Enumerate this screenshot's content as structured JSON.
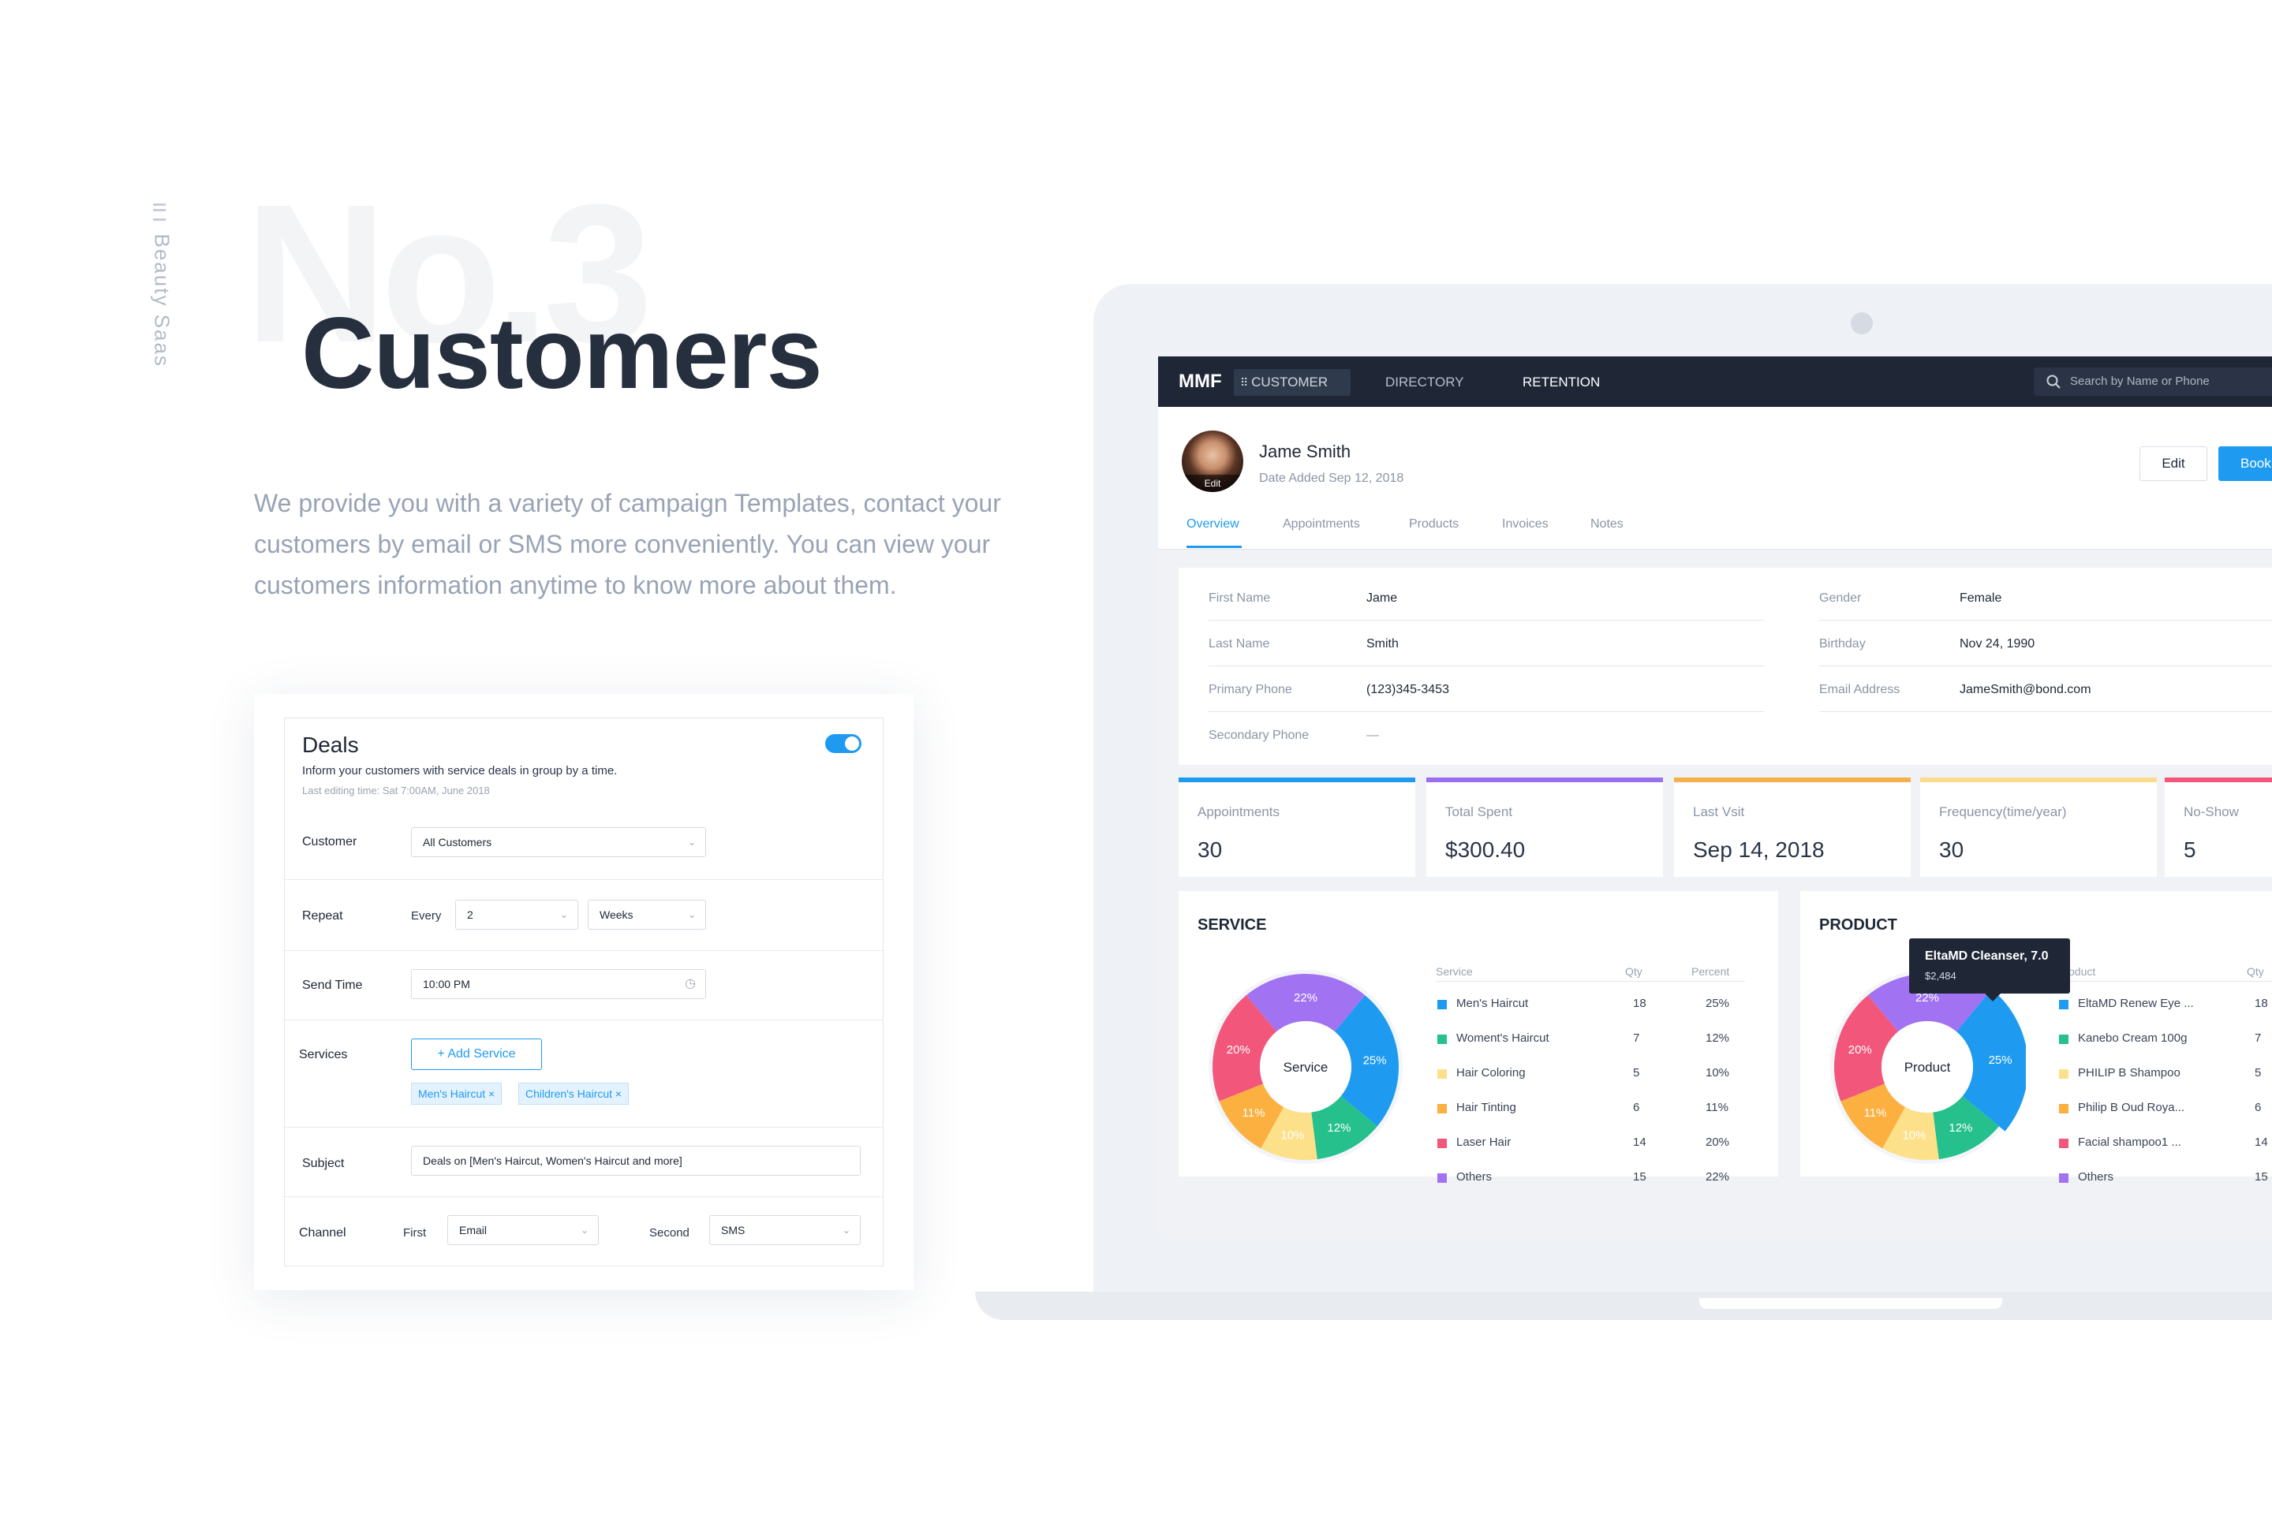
{
  "page": {
    "side_label": "Beauty Saas",
    "bg_number": "No.3",
    "title": "Customers",
    "description": "We provide you with a variety of campaign Templates, contact your customers by email or SMS more conveniently. You can view your customers information anytime to know more about them."
  },
  "deals": {
    "title": "Deals",
    "subtitle": "Inform your customers with service deals in group by a time.",
    "last_edit": "Last editing time: Sat 7:00AM, June 2018",
    "toggle_on": true,
    "customer_label": "Customer",
    "customer_value": "All Customers",
    "repeat_label": "Repeat",
    "every_label": "Every",
    "repeat_count": "2",
    "repeat_unit": "Weeks",
    "send_time_label": "Send Time",
    "send_time_value": "10:00 PM",
    "services_label": "Services",
    "add_service_label": "+ Add Service",
    "service_tags": [
      "Men's Haircut ×",
      "Children's Haircut ×"
    ],
    "subject_label": "Subject",
    "subject_value": "Deals on [Men's Haircut, Women's Haircut and more]",
    "channel_label": "Channel",
    "first_label": "First",
    "first_value": "Email",
    "second_label": "Second",
    "second_value": "SMS"
  },
  "nav": {
    "logo": "MMF",
    "items": [
      "CUSTOMER",
      "DIRECTORY",
      "RETENTION"
    ],
    "search_placeholder": "Search by Name or Phone"
  },
  "profile": {
    "name": "Jame Smith",
    "date_added": "Date Added Sep 12, 2018",
    "avatar_edit": "Edit",
    "edit_label": "Edit",
    "book_label": "Book",
    "tabs": [
      "Overview",
      "Appointments",
      "Products",
      "Invoices",
      "Notes"
    ]
  },
  "info": {
    "fields_left": [
      {
        "label": "First Name",
        "value": "Jame"
      },
      {
        "label": "Last Name",
        "value": "Smith"
      },
      {
        "label": "Primary Phone",
        "value": "(123)345-3453"
      },
      {
        "label": "Secondary Phone",
        "value": "—"
      }
    ],
    "fields_right": [
      {
        "label": "Gender",
        "value": "Female"
      },
      {
        "label": "Birthday",
        "value": "Nov 24, 1990"
      },
      {
        "label": "Email Address",
        "value": "JameSmith@bond.com"
      }
    ]
  },
  "stats": [
    {
      "label": "Appointments",
      "value": "30",
      "color": "#1e9bf0"
    },
    {
      "label": "Total Spent",
      "value": "$300.40",
      "color": "#9b6ef0"
    },
    {
      "label": "Last Vsit",
      "value": "Sep 14, 2018",
      "color": "#f6b04a"
    },
    {
      "label": "Frequency(time/year)",
      "value": "30",
      "color": "#fbdc8c"
    },
    {
      "label": "No-Show",
      "value": "5",
      "color": "#f2577b"
    }
  ],
  "service": {
    "title": "SERVICE",
    "center_label": "Service",
    "headers": [
      "Service",
      "Qty",
      "Percent"
    ],
    "rows": [
      {
        "name": "Men's Haircut",
        "qty": "18",
        "percent": "25%",
        "color": "#1e9bf0"
      },
      {
        "name": "Woment's Haircut",
        "qty": "7",
        "percent": "12%",
        "color": "#26c08c"
      },
      {
        "name": "Hair Coloring",
        "qty": "5",
        "percent": "10%",
        "color": "#fde08a"
      },
      {
        "name": "Hair Tinting",
        "qty": "6",
        "percent": "11%",
        "color": "#fbb040"
      },
      {
        "name": "Laser Hair",
        "qty": "14",
        "percent": "20%",
        "color": "#f2577b"
      },
      {
        "name": "Others",
        "qty": "15",
        "percent": "22%",
        "color": "#a173f2"
      }
    ]
  },
  "product": {
    "title": "PRODUCT",
    "center_label": "Product",
    "headers": [
      "Product",
      "Qty"
    ],
    "rows": [
      {
        "name": "EltaMD Renew Eye ...",
        "qty": "18",
        "color": "#1e9bf0"
      },
      {
        "name": "Kanebo Cream 100g",
        "qty": "7",
        "color": "#26c08c"
      },
      {
        "name": "PHILIP B Shampoo",
        "qty": "5",
        "color": "#fde08a"
      },
      {
        "name": "Philip B Oud Roya...",
        "qty": "6",
        "color": "#fbb040"
      },
      {
        "name": "Facial shampoo1 ...",
        "qty": "14",
        "color": "#f2577b"
      },
      {
        "name": "Others",
        "qty": "15",
        "color": "#a173f2"
      }
    ],
    "tooltip_title": "EltaMD Cleanser, 7.0",
    "tooltip_value": "$2,484"
  },
  "chart_data": [
    {
      "type": "pie",
      "title": "SERVICE",
      "categories": [
        "Men's Haircut",
        "Woment's Haircut",
        "Hair Coloring",
        "Hair Tinting",
        "Laser Hair",
        "Others"
      ],
      "values": [
        25,
        12,
        10,
        11,
        20,
        22
      ],
      "labels": [
        "25%",
        "12%",
        "10%",
        "11%",
        "20%",
        "22%"
      ],
      "colors": [
        "#1e9bf0",
        "#26c08c",
        "#fde08a",
        "#fbb040",
        "#f2577b",
        "#a173f2"
      ]
    },
    {
      "type": "pie",
      "title": "PRODUCT",
      "categories": [
        "EltaMD Renew Eye ...",
        "Kanebo Cream 100g",
        "PHILIP B Shampoo",
        "Philip B Oud Roya...",
        "Facial shampoo1 ...",
        "Others"
      ],
      "values": [
        25,
        12,
        10,
        11,
        20,
        22
      ],
      "labels": [
        "25%",
        "12%",
        "10%",
        "11%",
        "20%",
        "22%"
      ],
      "colors": [
        "#1e9bf0",
        "#26c08c",
        "#fde08a",
        "#fbb040",
        "#f2577b",
        "#a173f2"
      ],
      "highlighted": "EltaMD Renew Eye ..."
    }
  ]
}
